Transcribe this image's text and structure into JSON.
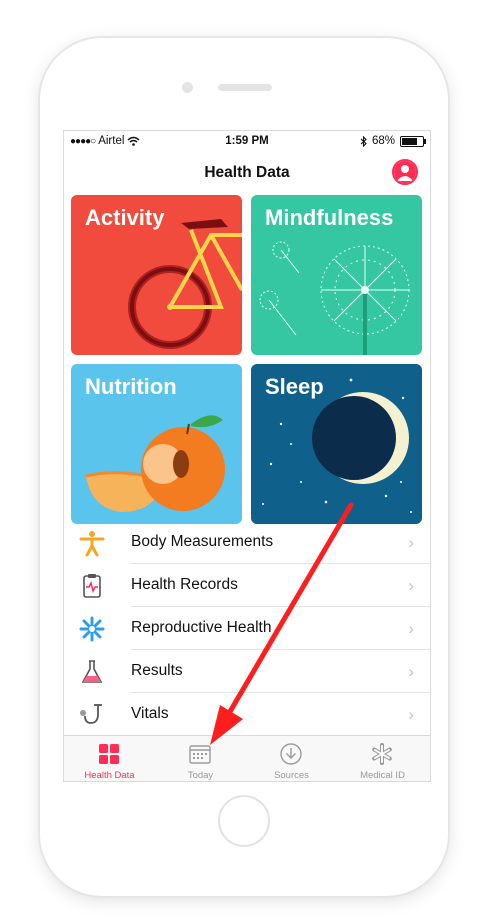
{
  "status_bar": {
    "carrier": "Airtel",
    "time": "1:59 PM",
    "battery": "68%",
    "battery_level": 0.68
  },
  "nav": {
    "title": "Health Data"
  },
  "tiles": [
    {
      "label": "Activity",
      "color": "#f14b3d"
    },
    {
      "label": "Mindfulness",
      "color": "#34c7a2"
    },
    {
      "label": "Nutrition",
      "color": "#5ac4ec"
    },
    {
      "label": "Sleep",
      "color": "#10608c"
    }
  ],
  "list": [
    {
      "label": "Body Measurements",
      "icon": "figure-icon"
    },
    {
      "label": "Health Records",
      "icon": "clipboard-icon"
    },
    {
      "label": "Reproductive Health",
      "icon": "snowflake-flower-icon"
    },
    {
      "label": "Results",
      "icon": "flask-icon"
    },
    {
      "label": "Vitals",
      "icon": "stethoscope-icon"
    }
  ],
  "tabs": [
    {
      "label": "Health Data",
      "active": true,
      "icon": "grid-icon"
    },
    {
      "label": "Today",
      "active": false,
      "icon": "calendar-icon"
    },
    {
      "label": "Sources",
      "active": false,
      "icon": "download-icon"
    },
    {
      "label": "Medical ID",
      "active": false,
      "icon": "asterisk-icon"
    }
  ],
  "colors": {
    "accent": "#ff2d55",
    "annotation_arrow": "#ff1e1e"
  }
}
